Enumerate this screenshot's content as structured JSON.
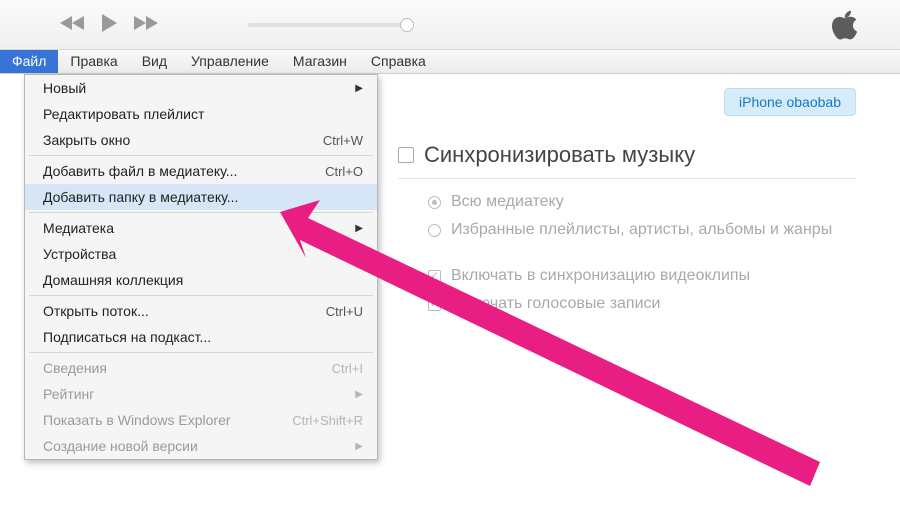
{
  "menubar": {
    "items": [
      "Файл",
      "Правка",
      "Вид",
      "Управление",
      "Магазин",
      "Справка"
    ],
    "open_index": 0
  },
  "dropdown": {
    "items": [
      {
        "label": "Новый",
        "submenu": true
      },
      {
        "label": "Редактировать плейлист"
      },
      {
        "label": "Закрыть окно",
        "shortcut": "Ctrl+W"
      },
      {
        "sep": true
      },
      {
        "label": "Добавить файл в медиатеку...",
        "shortcut": "Ctrl+O"
      },
      {
        "label": "Добавить папку в медиатеку...",
        "hover": true
      },
      {
        "sep": true
      },
      {
        "label": "Медиатека",
        "submenu": true
      },
      {
        "label": "Устройства",
        "submenu": true
      },
      {
        "label": "Домашняя коллекция"
      },
      {
        "sep": true
      },
      {
        "label": "Открыть поток...",
        "shortcut": "Ctrl+U"
      },
      {
        "label": "Подписаться на подкаст..."
      },
      {
        "sep": true
      },
      {
        "label": "Сведения",
        "shortcut": "Ctrl+I",
        "disabled": true
      },
      {
        "label": "Рейтинг",
        "submenu": true,
        "disabled": true
      },
      {
        "label": "Показать в Windows Explorer",
        "shortcut": "Ctrl+Shift+R",
        "disabled": true
      },
      {
        "label": "Создание новой версии",
        "submenu": true,
        "disabled": true
      }
    ]
  },
  "device": {
    "button_label": "iPhone obaobab"
  },
  "sync": {
    "title": "Синхронизировать музыку",
    "options": {
      "all": "Всю медиатеку",
      "selective": "Избранные плейлисты, артисты, альбомы и жанры",
      "include_videos": "Включать в синхронизацию видеоклипы",
      "include_voice": "Включать голосовые записи"
    }
  }
}
